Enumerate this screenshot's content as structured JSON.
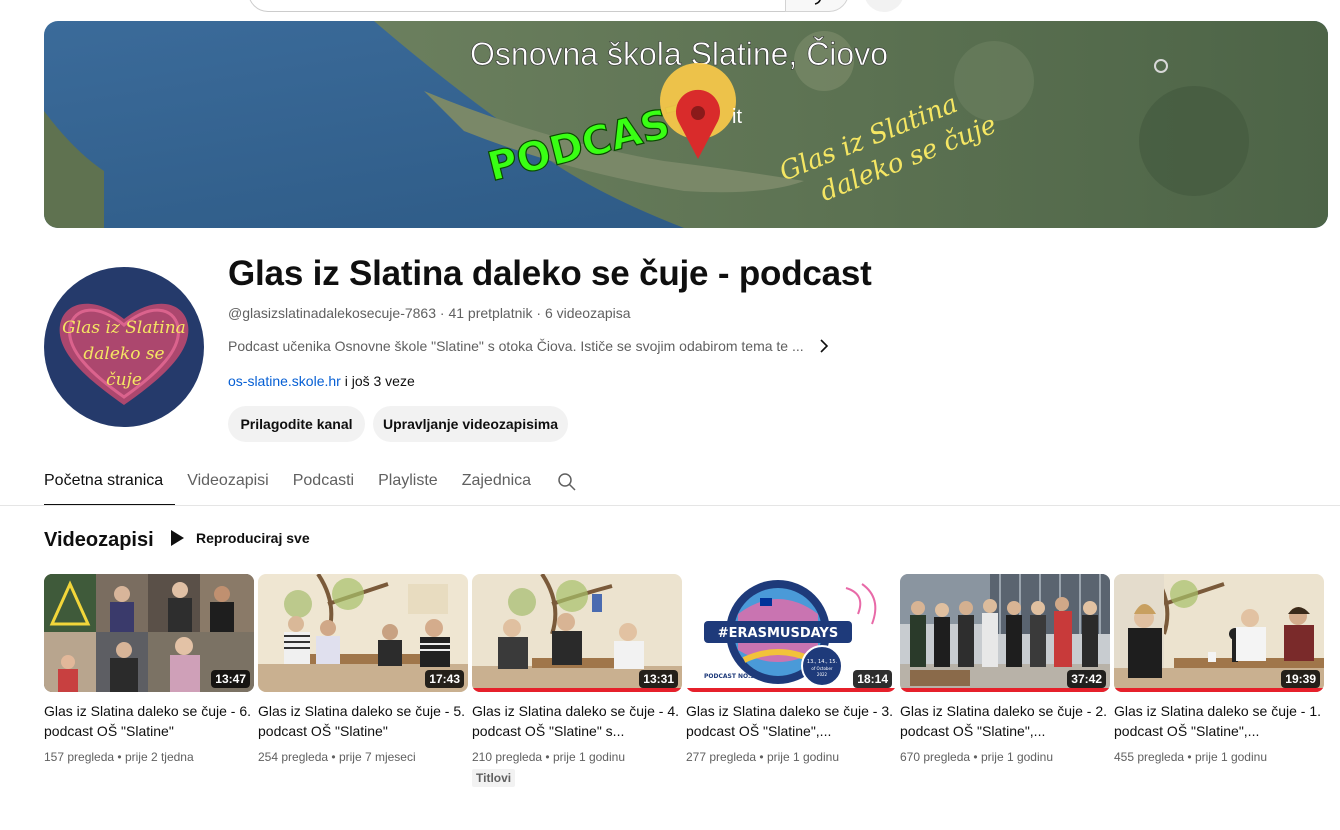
{
  "banner": {
    "title": "Osnovna škola Slatine, Čiovo",
    "podcast_text": "PODCAST",
    "script_line1": "Glas iz Slatina",
    "script_line2": "daleko se čuje",
    "map_label": "it"
  },
  "avatar": {
    "line1": "Glas iz Slatina",
    "line2": "daleko se",
    "line3": "čuje"
  },
  "channel": {
    "name": "Glas iz Slatina daleko se čuje - podcast",
    "meta": "@glasizslatinadalekosecuje-7863 · 41 pretplatnik · 6 videozapisa",
    "description": "Podcast učenika Osnovne škole \"Slatine\" s otoka Čiova. Ističe se svojim odabirom tema te ...",
    "link": "os-slatine.skole.hr",
    "more_links": "i još 3 veze",
    "customize_button": "Prilagodite kanal",
    "manage_button": "Upravljanje videozapisima"
  },
  "tabs": [
    "Početna stranica",
    "Videozapisi",
    "Podcasti",
    "Playliste",
    "Zajednica"
  ],
  "shelf": {
    "title": "Videozapisi",
    "play_all": "Reproduciraj sve"
  },
  "videos": [
    {
      "title": "Glas iz Slatina daleko se čuje - 6. podcast OŠ \"Slatine\"",
      "views": "157 pregleda",
      "age": "prije 2 tjedna",
      "duration": "13:47",
      "watched": 0.0
    },
    {
      "title": "Glas iz Slatina daleko se čuje - 5. podcast OŠ \"Slatine\"",
      "views": "254 pregleda",
      "age": "prije 7 mjeseci",
      "duration": "17:43",
      "watched": 0.0
    },
    {
      "title": "Glas iz Slatina daleko se čuje - 4. podcast OŠ \"Slatine\" s...",
      "views": "210 pregleda",
      "age": "prije 1 godinu",
      "duration": "13:31",
      "watched": 1.0,
      "badge": "Titlovi"
    },
    {
      "title": "Glas iz Slatina daleko se čuje - 3. podcast OŠ \"Slatine\",...",
      "views": "277 pregleda",
      "age": "prije 1 godinu",
      "duration": "18:14",
      "watched": 1.0
    },
    {
      "title": "Glas iz Slatina daleko se čuje - 2. podcast OŠ \"Slatine\",...",
      "views": "670 pregleda",
      "age": "prije 1 godinu",
      "duration": "37:42",
      "watched": 1.0
    },
    {
      "title": "Glas iz Slatina daleko se čuje - 1. podcast OŠ \"Slatine\",...",
      "views": "455 pregleda",
      "age": "prije 1 godinu",
      "duration": "19:39",
      "watched": 1.0
    }
  ],
  "thumb3_text": {
    "hashtag": "#ERASMUSDAYS",
    "podcast_no": "PODCAST NO.3",
    "dates": "13., 14., 15.",
    "month": "of October",
    "year": "2022"
  },
  "colors": {
    "accent_link": "#065fd4",
    "progress_red": "#e6202b",
    "podcast_green": "#39ff14",
    "script_yellow": "#f5e663"
  }
}
